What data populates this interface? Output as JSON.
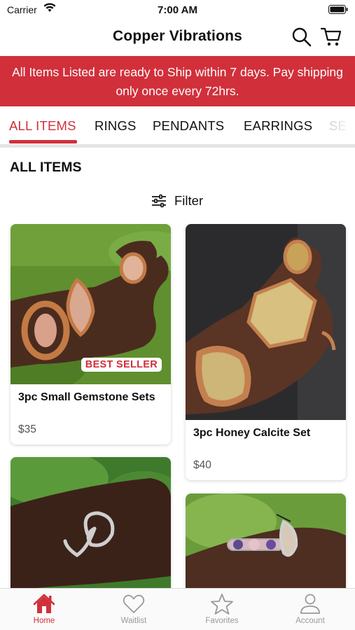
{
  "status_bar": {
    "carrier": "Carrier",
    "time": "7:00 AM"
  },
  "header": {
    "title": "Copper Vibrations"
  },
  "banner": {
    "text": "All Items Listed are ready to Ship within 7 days. Pay shipping only once every 72hrs."
  },
  "tabs": [
    {
      "label": "ALL ITEMS",
      "active": true
    },
    {
      "label": "RINGS"
    },
    {
      "label": "PENDANTS"
    },
    {
      "label": "EARRINGS"
    },
    {
      "label": "SE"
    }
  ],
  "section": {
    "title": "ALL ITEMS",
    "filter_label": "Filter"
  },
  "products": [
    {
      "name": "3pc Small Gemstone Sets",
      "price": "$35",
      "badge": "BEST SELLER"
    },
    {
      "name": "3pc Honey Calcite Set",
      "price": "$40"
    }
  ],
  "tab_bar": [
    {
      "label": "Home",
      "icon": "home-icon",
      "active": true
    },
    {
      "label": "Waitlist",
      "icon": "heart-icon"
    },
    {
      "label": "Favorites",
      "icon": "star-icon"
    },
    {
      "label": "Account",
      "icon": "person-icon"
    }
  ],
  "colors": {
    "accent": "#d1303b",
    "inactive": "#999999",
    "divider": "#e5e5e5"
  }
}
